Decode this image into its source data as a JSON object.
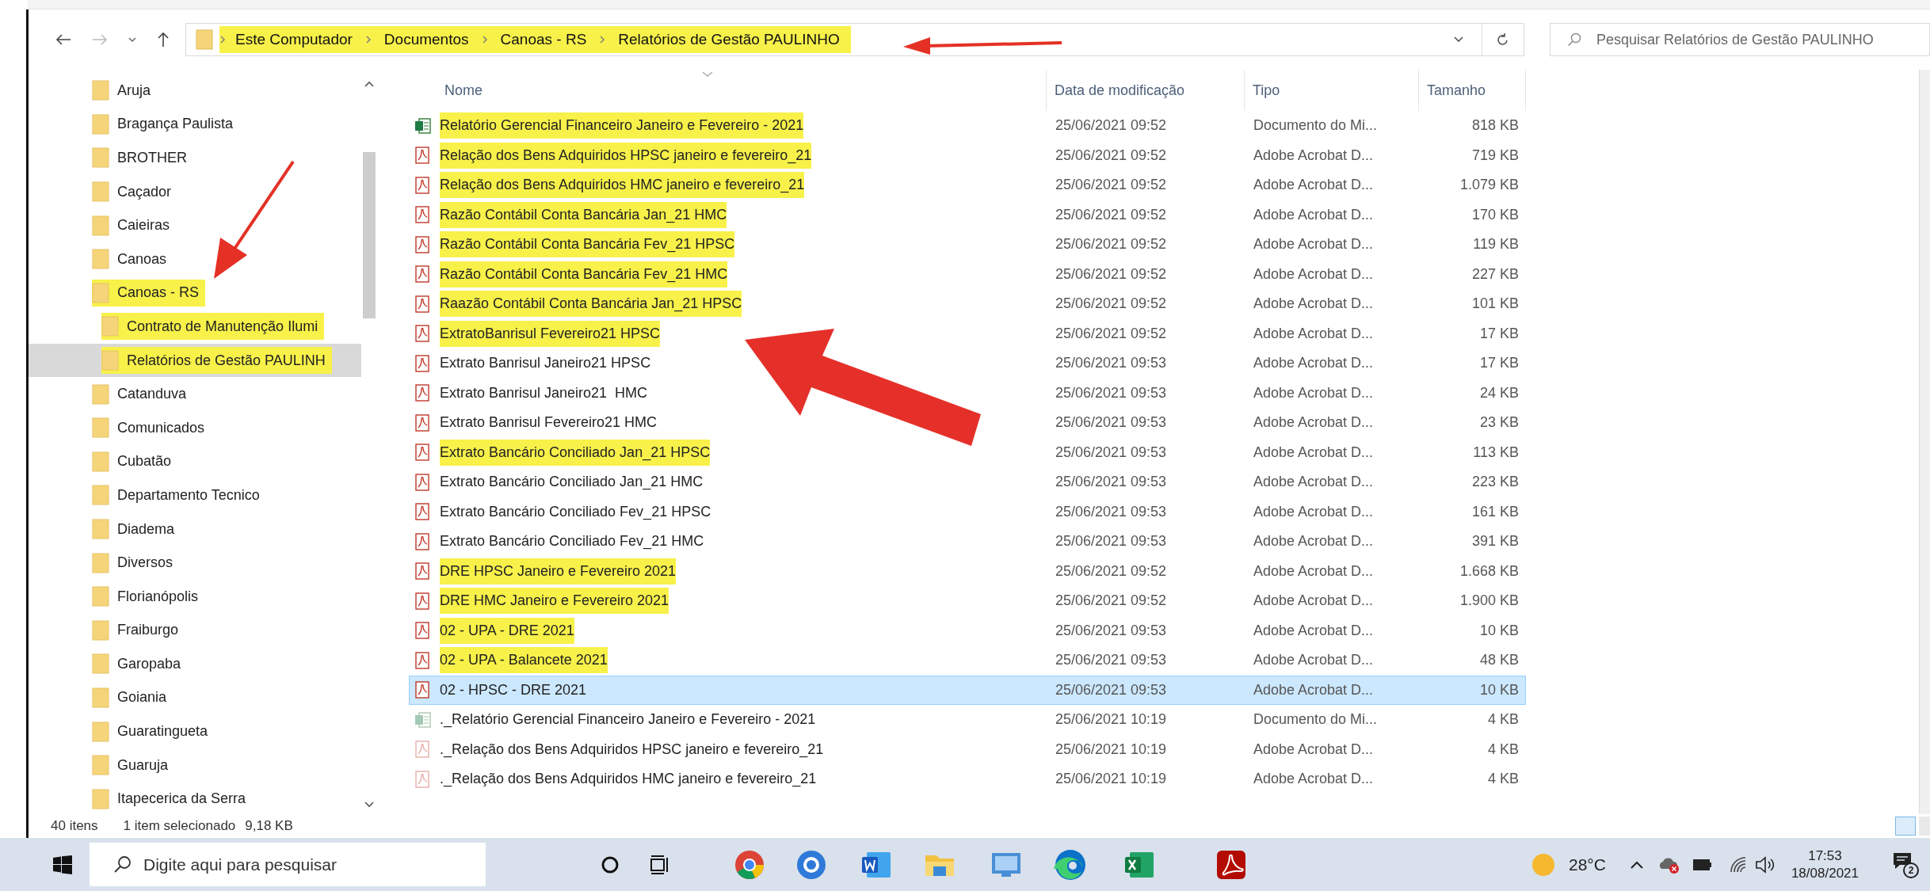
{
  "address_bar": {
    "crumbs": [
      "Este Computador",
      "Documentos",
      "Canoas - RS",
      "Relatórios de Gestão PAULINHO"
    ],
    "highlighted": true
  },
  "search": {
    "placeholder": "Pesquisar Relatórios de Gestão PAULINHO"
  },
  "navigation": {
    "items": [
      {
        "label": "Aruja",
        "selected": false,
        "highlighted": false
      },
      {
        "label": "Bragança Paulista",
        "selected": false,
        "highlighted": false
      },
      {
        "label": "BROTHER",
        "selected": false,
        "highlighted": false
      },
      {
        "label": "Caçador",
        "selected": false,
        "highlighted": false
      },
      {
        "label": "Caieiras",
        "selected": false,
        "highlighted": false
      },
      {
        "label": "Canoas",
        "selected": false,
        "highlighted": false
      },
      {
        "label": "Canoas - RS",
        "selected": false,
        "highlighted": true,
        "children": [
          {
            "label": "Contrato de Manutenção Ilumi",
            "selected": false,
            "highlighted": true
          },
          {
            "label": "Relatórios de Gestão PAULINH",
            "selected": true,
            "highlighted": true
          }
        ]
      },
      {
        "label": "Catanduva",
        "selected": false,
        "highlighted": false
      },
      {
        "label": "Comunicados",
        "selected": false,
        "highlighted": false
      },
      {
        "label": "Cubatão",
        "selected": false,
        "highlighted": false
      },
      {
        "label": "Departamento Tecnico",
        "selected": false,
        "highlighted": false
      },
      {
        "label": "Diadema",
        "selected": false,
        "highlighted": false
      },
      {
        "label": "Diversos",
        "selected": false,
        "highlighted": false
      },
      {
        "label": "Florianópolis",
        "selected": false,
        "highlighted": false
      },
      {
        "label": "Fraiburgo",
        "selected": false,
        "highlighted": false
      },
      {
        "label": "Garopaba",
        "selected": false,
        "highlighted": false
      },
      {
        "label": "Goiania",
        "selected": false,
        "highlighted": false
      },
      {
        "label": "Guaratingueta",
        "selected": false,
        "highlighted": false
      },
      {
        "label": "Guaruja",
        "selected": false,
        "highlighted": false
      },
      {
        "label": "Itapecerica da Serra",
        "selected": false,
        "highlighted": false
      }
    ]
  },
  "columns": [
    "Nome",
    "Data de modificação",
    "Tipo",
    "Tamanho"
  ],
  "files": [
    {
      "name": "Relatório Gerencial Financeiro Janeiro e Fevereiro - 2021",
      "modified": "25/06/2021 09:52",
      "type": "Documento do Mi...",
      "size": "818 KB",
      "kind": "sheet",
      "selected": false,
      "highlighted": true
    },
    {
      "name": "Relação dos Bens Adquiridos HPSC janeiro e fevereiro_21",
      "modified": "25/06/2021 09:52",
      "type": "Adobe Acrobat D...",
      "size": "719 KB",
      "kind": "pdf",
      "selected": false,
      "highlighted": true
    },
    {
      "name": "Relação dos Bens Adquiridos HMC janeiro e fevereiro_21",
      "modified": "25/06/2021 09:52",
      "type": "Adobe Acrobat D...",
      "size": "1.079 KB",
      "kind": "pdf",
      "selected": false,
      "highlighted": true
    },
    {
      "name": "Razão Contábil Conta Bancária Jan_21 HMC",
      "modified": "25/06/2021 09:52",
      "type": "Adobe Acrobat D...",
      "size": "170 KB",
      "kind": "pdf",
      "selected": false,
      "highlighted": true
    },
    {
      "name": "Razão Contábil Conta Bancária Fev_21 HPSC",
      "modified": "25/06/2021 09:52",
      "type": "Adobe Acrobat D...",
      "size": "119 KB",
      "kind": "pdf",
      "selected": false,
      "highlighted": true
    },
    {
      "name": "Razão Contábil Conta Bancária Fev_21 HMC",
      "modified": "25/06/2021 09:52",
      "type": "Adobe Acrobat D...",
      "size": "227 KB",
      "kind": "pdf",
      "selected": false,
      "highlighted": true
    },
    {
      "name": "Raazão Contábil Conta Bancária Jan_21 HPSC",
      "modified": "25/06/2021 09:52",
      "type": "Adobe Acrobat D...",
      "size": "101 KB",
      "kind": "pdf",
      "selected": false,
      "highlighted": true
    },
    {
      "name": "ExtratoBanrisul Fevereiro21 HPSC",
      "modified": "25/06/2021 09:52",
      "type": "Adobe Acrobat D...",
      "size": "17 KB",
      "kind": "pdf",
      "selected": false,
      "highlighted": true
    },
    {
      "name": "Extrato Banrisul Janeiro21 HPSC",
      "modified": "25/06/2021 09:53",
      "type": "Adobe Acrobat D...",
      "size": "17 KB",
      "kind": "pdf",
      "selected": false,
      "highlighted": false
    },
    {
      "name": "Extrato Banrisul Janeiro21  HMC",
      "modified": "25/06/2021 09:53",
      "type": "Adobe Acrobat D...",
      "size": "24 KB",
      "kind": "pdf",
      "selected": false,
      "highlighted": false
    },
    {
      "name": "Extrato Banrisul Fevereiro21 HMC",
      "modified": "25/06/2021 09:53",
      "type": "Adobe Acrobat D...",
      "size": "23 KB",
      "kind": "pdf",
      "selected": false,
      "highlighted": false
    },
    {
      "name": "Extrato Bancário Conciliado Jan_21 HPSC",
      "modified": "25/06/2021 09:53",
      "type": "Adobe Acrobat D...",
      "size": "113 KB",
      "kind": "pdf",
      "selected": false,
      "highlighted": true
    },
    {
      "name": "Extrato Bancário Conciliado Jan_21 HMC",
      "modified": "25/06/2021 09:53",
      "type": "Adobe Acrobat D...",
      "size": "223 KB",
      "kind": "pdf",
      "selected": false,
      "highlighted": false
    },
    {
      "name": "Extrato Bancário Conciliado Fev_21 HPSC",
      "modified": "25/06/2021 09:53",
      "type": "Adobe Acrobat D...",
      "size": "161 KB",
      "kind": "pdf",
      "selected": false,
      "highlighted": false
    },
    {
      "name": "Extrato Bancário Conciliado Fev_21 HMC",
      "modified": "25/06/2021 09:53",
      "type": "Adobe Acrobat D...",
      "size": "391 KB",
      "kind": "pdf",
      "selected": false,
      "highlighted": false
    },
    {
      "name": "DRE HPSC Janeiro e Fevereiro 2021",
      "modified": "25/06/2021 09:52",
      "type": "Adobe Acrobat D...",
      "size": "1.668 KB",
      "kind": "pdf",
      "selected": false,
      "highlighted": true
    },
    {
      "name": "DRE HMC Janeiro e Fevereiro 2021",
      "modified": "25/06/2021 09:52",
      "type": "Adobe Acrobat D...",
      "size": "1.900 KB",
      "kind": "pdf",
      "selected": false,
      "highlighted": true
    },
    {
      "name": "02 - UPA - DRE 2021",
      "modified": "25/06/2021 09:53",
      "type": "Adobe Acrobat D...",
      "size": "10 KB",
      "kind": "pdf",
      "selected": false,
      "highlighted": true
    },
    {
      "name": "02 - UPA - Balancete 2021",
      "modified": "25/06/2021 09:53",
      "type": "Adobe Acrobat D...",
      "size": "48 KB",
      "kind": "pdf",
      "selected": false,
      "highlighted": true
    },
    {
      "name": "02 - HPSC - DRE 2021",
      "modified": "25/06/2021 09:53",
      "type": "Adobe Acrobat D...",
      "size": "10 KB",
      "kind": "pdf",
      "selected": true,
      "highlighted": false
    },
    {
      "name": "._Relatório Gerencial Financeiro Janeiro e Fevereiro - 2021",
      "modified": "25/06/2021 10:19",
      "type": "Documento do Mi...",
      "size": "4 KB",
      "kind": "sheet-ghost",
      "selected": false,
      "highlighted": false
    },
    {
      "name": "._Relação dos Bens Adquiridos HPSC janeiro e fevereiro_21",
      "modified": "25/06/2021 10:19",
      "type": "Adobe Acrobat D...",
      "size": "4 KB",
      "kind": "pdf-ghost",
      "selected": false,
      "highlighted": false
    },
    {
      "name": "._Relação dos Bens Adquiridos HMC janeiro e fevereiro_21",
      "modified": "25/06/2021 10:19",
      "type": "Adobe Acrobat D...",
      "size": "4 KB",
      "kind": "pdf-ghost",
      "selected": false,
      "highlighted": false
    }
  ],
  "status_bar": {
    "count": "40 itens",
    "selection": "1 item selecionado",
    "selection_size": "9,18 KB"
  },
  "taskbar": {
    "search_placeholder": "Digite aqui para pesquisar",
    "weather": "28°C",
    "time": "17:53",
    "date": "18/08/2021",
    "notifications": "2"
  }
}
